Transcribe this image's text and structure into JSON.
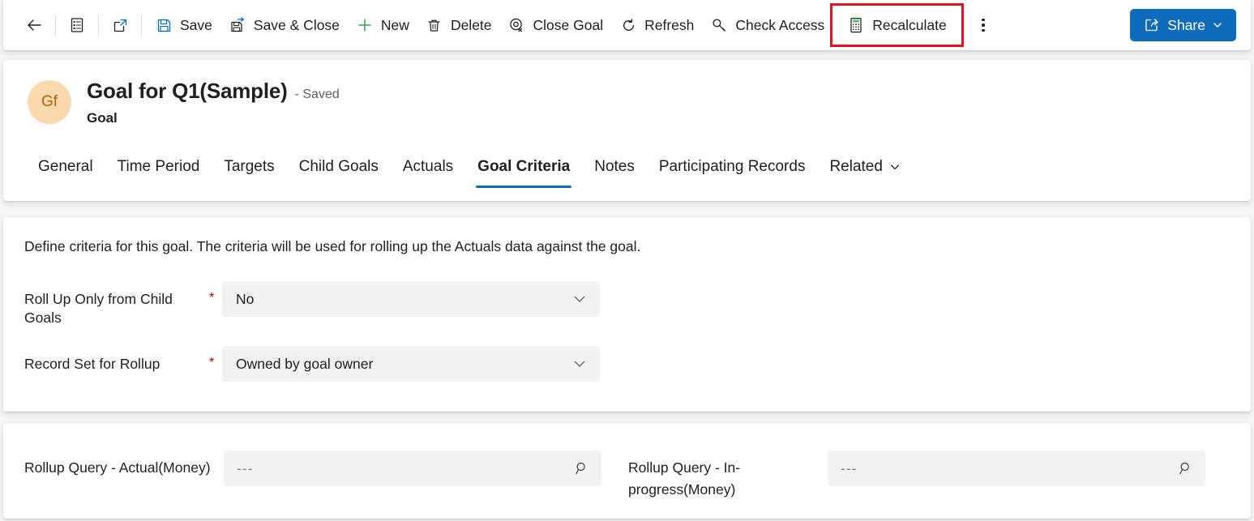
{
  "commandbar": {
    "buttons": [
      {
        "name": "back",
        "icon": "back-arrow-icon",
        "label": ""
      },
      {
        "name": "form-selector",
        "icon": "form-icon",
        "label": ""
      },
      {
        "name": "open-new-window",
        "icon": "open-in-new-window-icon",
        "label": ""
      },
      {
        "name": "save",
        "icon": "save-icon",
        "label": "Save"
      },
      {
        "name": "save-and-close",
        "icon": "save-and-close-icon",
        "label": "Save & Close"
      },
      {
        "name": "new",
        "icon": "plus-icon",
        "label": "New"
      },
      {
        "name": "delete",
        "icon": "trash-icon",
        "label": "Delete"
      },
      {
        "name": "close-goal",
        "icon": "close-goal-icon",
        "label": "Close Goal"
      },
      {
        "name": "refresh",
        "icon": "refresh-icon",
        "label": "Refresh"
      },
      {
        "name": "check-access",
        "icon": "key-icon",
        "label": "Check Access"
      },
      {
        "name": "recalculate",
        "icon": "calculator-icon",
        "label": "Recalculate"
      }
    ],
    "overflow_label": "More commands",
    "share_label": "Share",
    "highlight_color": "#e81123",
    "accent_color": "#0f6cbd"
  },
  "header": {
    "avatar_initials": "Gf",
    "avatar_bg": "#fbd9ae",
    "avatar_fg": "#b3620a",
    "title": "Goal for Q1(Sample)",
    "saved_state": "- Saved",
    "entity": "Goal"
  },
  "tabs": [
    {
      "label": "General",
      "active": false
    },
    {
      "label": "Time Period",
      "active": false
    },
    {
      "label": "Targets",
      "active": false
    },
    {
      "label": "Child Goals",
      "active": false
    },
    {
      "label": "Actuals",
      "active": false
    },
    {
      "label": "Goal Criteria",
      "active": true
    },
    {
      "label": "Notes",
      "active": false
    },
    {
      "label": "Participating Records",
      "active": false
    },
    {
      "label": "Related",
      "active": false,
      "has_chevron": true
    }
  ],
  "criteria_section": {
    "description": "Define criteria for this goal. The criteria will be used for rolling up the Actuals data against the goal.",
    "fields": [
      {
        "label": "Roll Up Only from Child Goals",
        "required": true,
        "value": "No"
      },
      {
        "label": "Record Set for Rollup",
        "required": true,
        "value": "Owned by goal owner"
      }
    ]
  },
  "rollup_section": {
    "fields": [
      {
        "label": "Rollup Query - Actual(Money)",
        "value": "---"
      },
      {
        "label": "Rollup Query - In-progress(Money)",
        "value": "---"
      }
    ]
  }
}
